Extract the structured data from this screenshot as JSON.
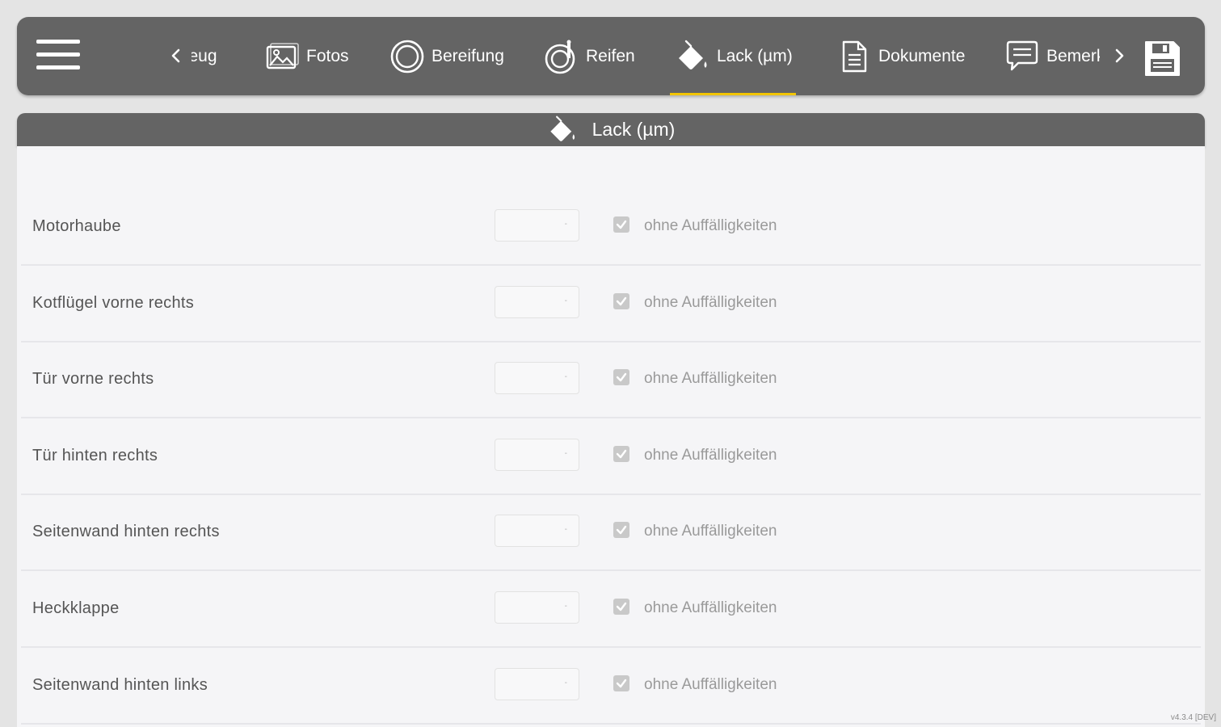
{
  "toolbar": {
    "tabs": [
      {
        "label": "zeug",
        "icon": "car-icon"
      },
      {
        "label": "Fotos",
        "icon": "image-icon"
      },
      {
        "label": "Bereifung",
        "icon": "tire-icon"
      },
      {
        "label": "Reifen",
        "icon": "tire-gauge-icon"
      },
      {
        "label": "Lack (µm)",
        "icon": "paint-bucket-icon",
        "active": true
      },
      {
        "label": "Dokumente",
        "icon": "document-icon"
      },
      {
        "label": "Bemerkungen",
        "icon": "comment-icon"
      }
    ],
    "active_color": "#f2c500",
    "bar_color": "#646464"
  },
  "panel": {
    "title": "Lack (µm)",
    "icon": "paint-bucket-icon"
  },
  "rows": [
    {
      "part": "Motorhaube",
      "value": "-",
      "checkbox_label": "ohne Auffälligkeiten",
      "checked": true
    },
    {
      "part": "Kotflügel vorne rechts",
      "value": "-",
      "checkbox_label": "ohne Auffälligkeiten",
      "checked": true
    },
    {
      "part": "Tür vorne rechts",
      "value": "-",
      "checkbox_label": "ohne Auffälligkeiten",
      "checked": true
    },
    {
      "part": "Tür hinten rechts",
      "value": "-",
      "checkbox_label": "ohne Auffälligkeiten",
      "checked": true
    },
    {
      "part": "Seitenwand hinten rechts",
      "value": "-",
      "checkbox_label": "ohne Auffälligkeiten",
      "checked": true
    },
    {
      "part": "Heckklappe",
      "value": "-",
      "checkbox_label": "ohne Auffälligkeiten",
      "checked": true
    },
    {
      "part": "Seitenwand hinten links",
      "value": "-",
      "checkbox_label": "ohne Auffälligkeiten",
      "checked": true
    }
  ],
  "version": "v4.3.4 [DEV]"
}
